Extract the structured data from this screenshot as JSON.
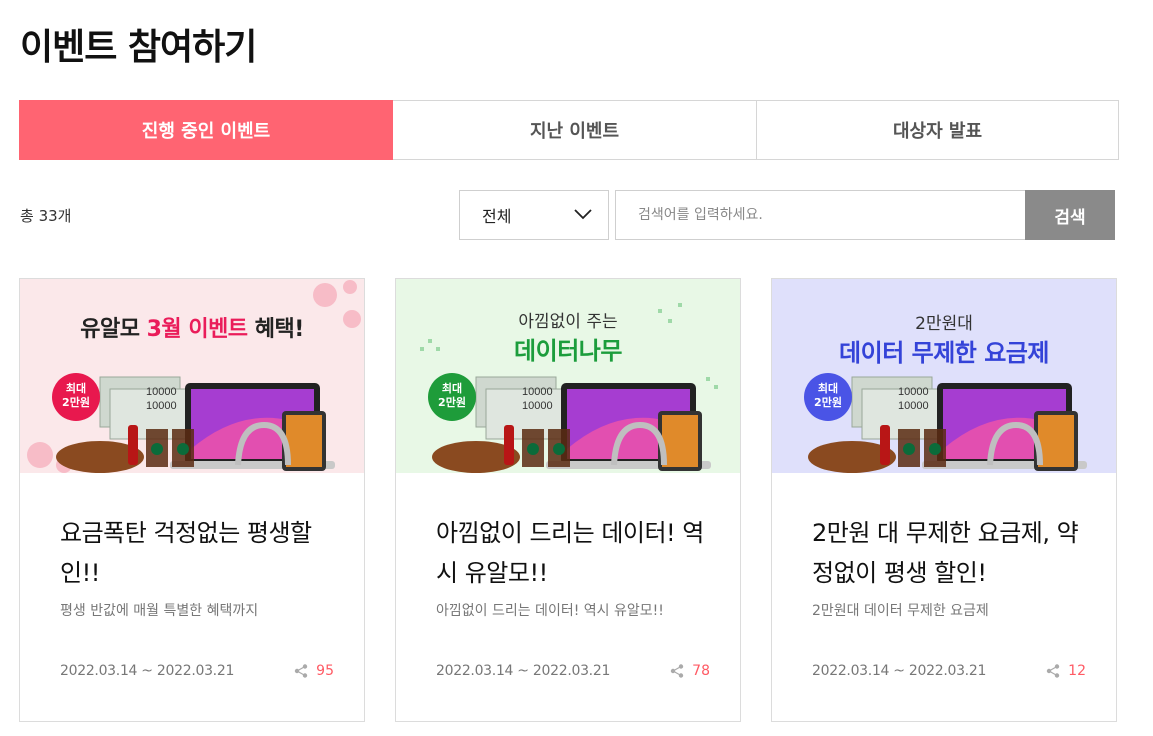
{
  "page_title": "이벤트 참여하기",
  "tabs": [
    {
      "label": "진행 중인 이벤트",
      "active": true
    },
    {
      "label": "지난 이벤트",
      "active": false
    },
    {
      "label": "대상자 발표",
      "active": false
    }
  ],
  "total_text": "총 33개",
  "filter": {
    "selected": "전체",
    "icon": "chevron-down-icon"
  },
  "search": {
    "placeholder": "검색어를 입력하세요.",
    "button_label": "검색"
  },
  "colors": {
    "accent": "#ff6472",
    "search_button": "#8a8a8a",
    "share_count": "#ff5a64"
  },
  "cards": [
    {
      "banner": {
        "main_prefix": "유알모 ",
        "main_highlight": "3월 이벤트",
        "main_suffix": " 혜택!",
        "badge_line1": "최대",
        "badge_line2": "2만원"
      },
      "title": "요금폭탄 걱정없는 평생할인!!",
      "description": "평생 반값에 매월 특별한 혜택까지",
      "date_range": "2022.03.14 ~ 2022.03.21",
      "share_count": "95"
    },
    {
      "banner": {
        "top_text": "아낌없이 주는",
        "main_text": "데이터나무",
        "badge_line1": "최대",
        "badge_line2": "2만원"
      },
      "title": "아낌없이 드리는 데이터! 역시 유알모!!",
      "description": "아낌없이 드리는 데이터! 역시 유알모!!",
      "date_range": "2022.03.14 ~ 2022.03.21",
      "share_count": "78"
    },
    {
      "banner": {
        "top_text": "2만원대",
        "main_text": "데이터 무제한 요금제",
        "badge_line1": "최대",
        "badge_line2": "2만원"
      },
      "title": "2만원 대 무제한 요금제, 약정없이 평생 할인!",
      "description": "2만원대 데이터 무제한 요금제",
      "date_range": "2022.03.14 ~ 2022.03.21",
      "share_count": "12"
    }
  ]
}
